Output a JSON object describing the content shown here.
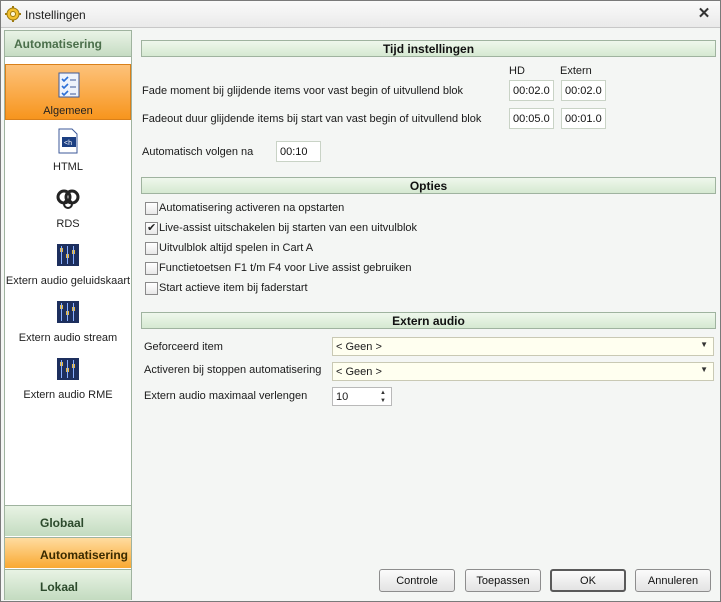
{
  "window": {
    "title": "Instellingen"
  },
  "nav": {
    "header": "Automatisering",
    "items": [
      {
        "label": "Algemeen",
        "icon": "checklist-icon",
        "active": true
      },
      {
        "label": "HTML",
        "icon": "html-document-icon",
        "active": false
      },
      {
        "label": "RDS",
        "icon": "rds-icon",
        "active": false
      },
      {
        "label": "Extern audio geluidskaart",
        "icon": "audio-mixer-icon",
        "active": false
      },
      {
        "label": "Extern audio stream",
        "icon": "audio-mixer-icon",
        "active": false
      },
      {
        "label": "Extern audio RME",
        "icon": "audio-mixer-icon",
        "active": false
      }
    ],
    "bottom": [
      {
        "label": "Globaal",
        "selected": false
      },
      {
        "label": "Automatisering",
        "selected": true
      },
      {
        "label": "Lokaal",
        "selected": false
      }
    ]
  },
  "tijd": {
    "header": "Tijd instellingen",
    "col_hd": "HD",
    "col_extern": "Extern",
    "fade_label": "Fade moment bij glijdende items voor vast begin of uitvullend blok",
    "fade_hd": "00:02.0",
    "fade_extern": "00:02.0",
    "fadeout_label": "Fadeout duur glijdende items bij start van vast begin of uitvullend blok",
    "fadeout_hd": "00:05.0",
    "fadeout_extern": "00:01.0",
    "auto_label": "Automatisch volgen na",
    "auto_value": "00:10"
  },
  "opties": {
    "header": "Opties",
    "items": [
      {
        "label": "Automatisering activeren na opstarten",
        "checked": false
      },
      {
        "label": "Live-assist uitschakelen bij starten van een uitvulblok",
        "checked": true
      },
      {
        "label": "Uitvulblok altijd spelen in Cart A",
        "checked": false
      },
      {
        "label": "Functietoetsen F1 t/m F4 voor Live assist gebruiken",
        "checked": false
      },
      {
        "label": "Start actieve item bij faderstart",
        "checked": false
      }
    ]
  },
  "extern": {
    "header": "Extern audio",
    "geforceerd_label": "Geforceerd item",
    "geforceerd_value": "< Geen >",
    "activeren_label": "Activeren bij stoppen automatisering",
    "activeren_value": "< Geen >",
    "max_label": "Extern audio maximaal verlengen",
    "max_value": "10"
  },
  "buttons": {
    "controle": "Controle",
    "toepassen": "Toepassen",
    "ok": "OK",
    "annuleren": "Annuleren"
  },
  "colors": {
    "active_nav": "#f7951d",
    "section_header": "#d5e9d1",
    "combo_bg": "#fffff0"
  }
}
